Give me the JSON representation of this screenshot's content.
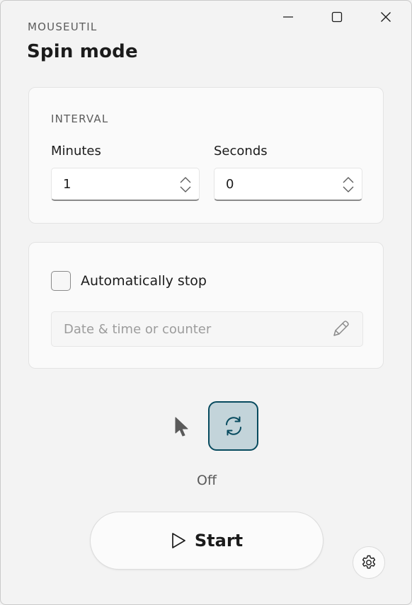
{
  "header": {
    "app_name": "MOUSEUTIL",
    "page_title": "Spin mode"
  },
  "window_controls": [
    "minimize-icon",
    "maximize-icon",
    "close-icon"
  ],
  "interval": {
    "section_label": "INTERVAL",
    "minutes_label": "Minutes",
    "minutes_value": "1",
    "seconds_label": "Seconds",
    "seconds_value": "0"
  },
  "auto_stop": {
    "checkbox_label": "Automatically stop",
    "checked": false,
    "input_placeholder": "Date & time or counter"
  },
  "status": {
    "toggle_icon": "sync-icon",
    "text": "Off"
  },
  "actions": {
    "start_label": "Start",
    "start_icon": "play-icon",
    "settings_icon": "gear-icon"
  },
  "colors": {
    "accent": "#074a5e",
    "toggle_fill": "#c3d4da"
  }
}
